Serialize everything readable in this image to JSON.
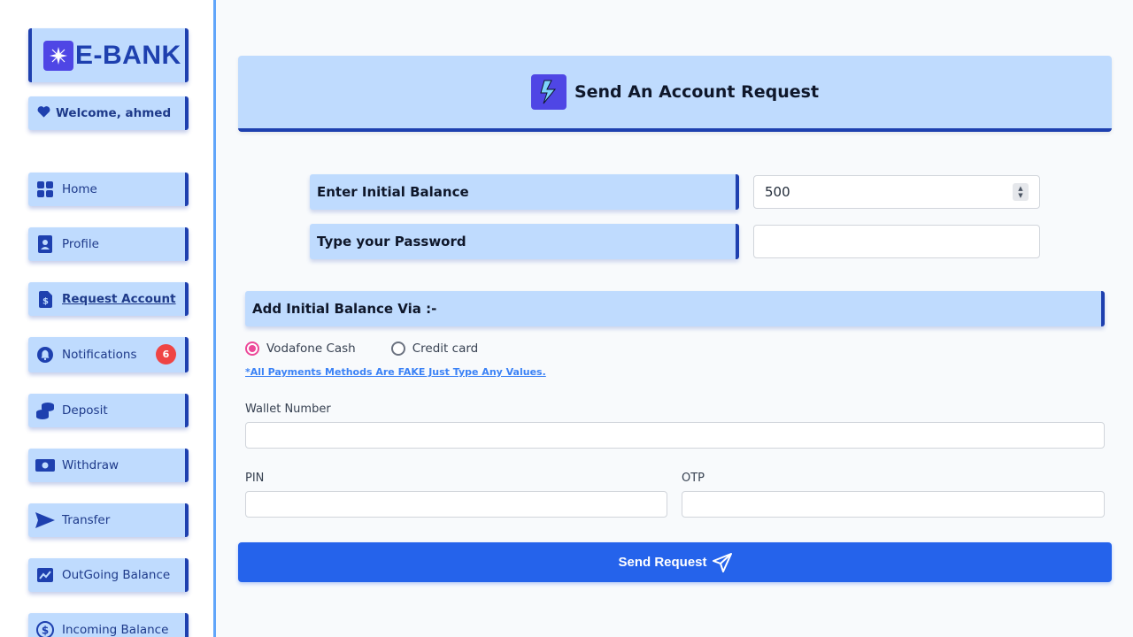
{
  "brand": {
    "logo_text": "E-BANK",
    "icon": "sparkle-icon"
  },
  "sidebar": {
    "welcome": "Welcome, ahmed",
    "items": [
      {
        "label": "Home",
        "icon": "grid-icon"
      },
      {
        "label": "Profile",
        "icon": "profile-card-icon"
      },
      {
        "label": "Request Account",
        "icon": "dollar-document-icon",
        "active": true
      },
      {
        "label": "Notifications",
        "icon": "bell-icon",
        "badge": "6"
      },
      {
        "label": "Deposit",
        "icon": "coins-icon"
      },
      {
        "label": "Withdraw",
        "icon": "banknote-icon"
      },
      {
        "label": "Transfer",
        "icon": "send-icon"
      },
      {
        "label": "OutGoing Balance",
        "icon": "chart-up-icon"
      },
      {
        "label": "Incoming Balance",
        "icon": "dollar-circle-icon"
      }
    ]
  },
  "main": {
    "title": "Send An Account Request",
    "title_icon": "lightning-icon",
    "initial_balance_label": "Enter Initial Balance",
    "initial_balance_value": "500",
    "password_label": "Type your Password",
    "password_value": "",
    "section_title": "Add Initial Balance Via :-",
    "payment_options": [
      {
        "label": "Vodafone Cash",
        "selected": true
      },
      {
        "label": "Credit card",
        "selected": false
      }
    ],
    "note": "*All Payments Methods Are FAKE Just Type Any Values.",
    "wallet_label": "Wallet Number",
    "pin_label": "PIN",
    "otp_label": "OTP",
    "submit_label": "Send Request"
  },
  "colors": {
    "accent": "#1e40af",
    "light_blue": "#bfdbfe",
    "button": "#2563eb",
    "badge": "#ef4444",
    "radio_selected": "#ec4899"
  }
}
